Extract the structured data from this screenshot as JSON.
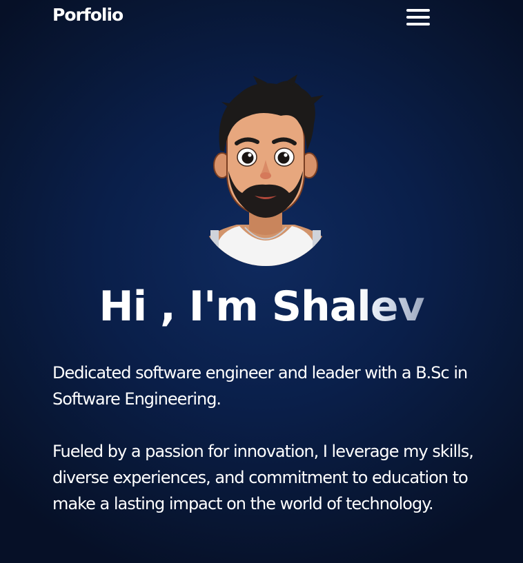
{
  "nav": {
    "brand": "Porfolio",
    "menu_icon": "hamburger-menu-icon"
  },
  "hero": {
    "avatar_icon": "cartoon-avatar-portrait",
    "greeting_main": "Hi , I'm Sha",
    "greeting_fade": "lev",
    "paragraphs": [
      "Dedicated software engineer and leader with a B.Sc in Software Engineering.",
      "Fueled by a passion for innovation, I leverage my skills, diverse experiences, and commitment to education to make a lasting impact on the world of technology."
    ]
  },
  "colors": {
    "background": "#0a1f4a",
    "text": "#ffffff",
    "faded_text": "#9aa6be"
  }
}
